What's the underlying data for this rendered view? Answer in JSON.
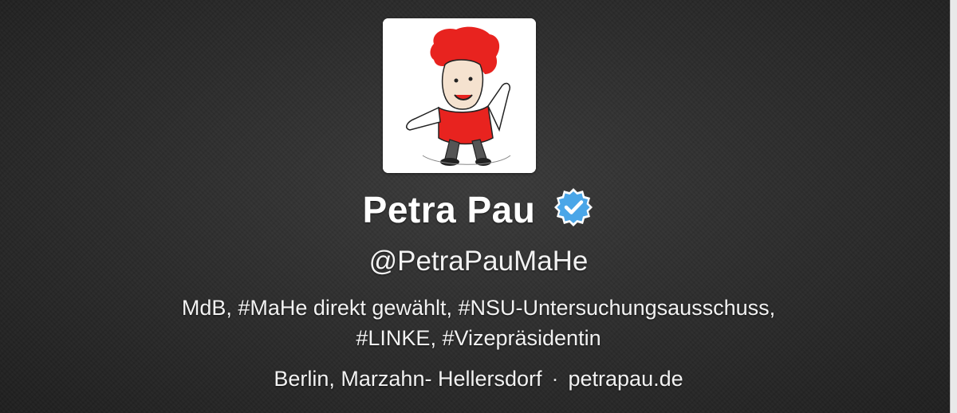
{
  "profile": {
    "name": "Petra Pau",
    "handle": "@PetraPauMaHe",
    "verified_icon": "verified-badge-icon",
    "bio_line1": "MdB, #MaHe direkt gewählt, #NSU-Untersuchungsausschuss,",
    "bio_line2": "#LINKE, #Vizepräsidentin",
    "location": "Berlin, Marzahn- Hellersdorf",
    "separator": "·",
    "url": "petrapau.de"
  },
  "colors": {
    "background": "#2b2b2b",
    "text": "#ffffff",
    "verified_blue": "#4aa6e8",
    "avatar_hair": "#e8231f"
  }
}
